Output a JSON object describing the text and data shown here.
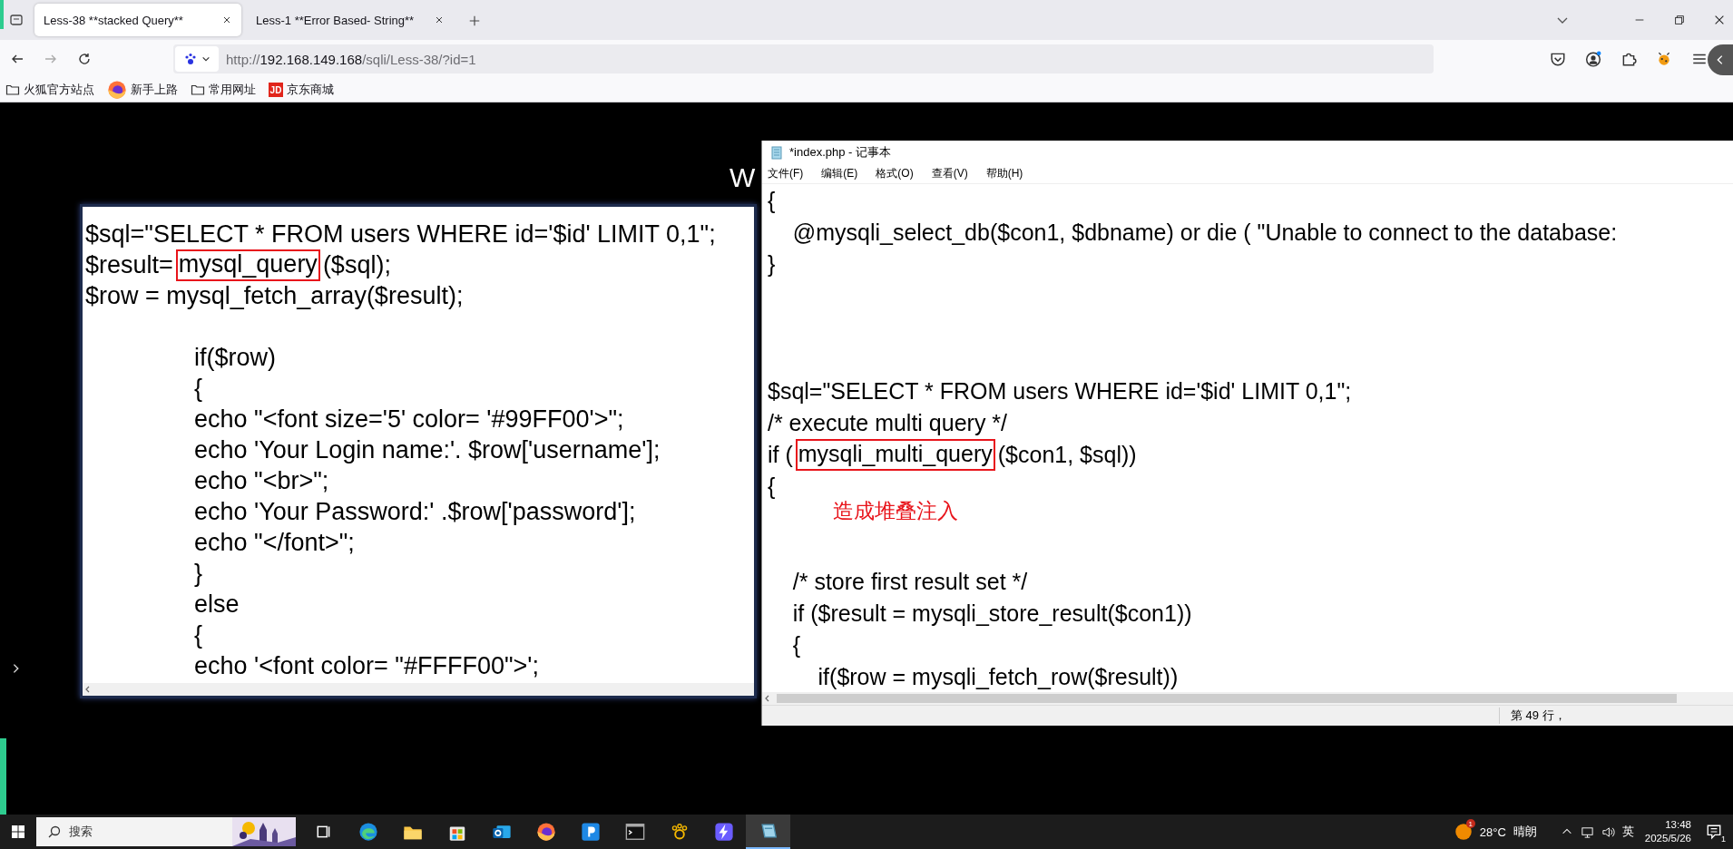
{
  "browser": {
    "tabs": [
      {
        "title": "Less-38 **stacked Query**",
        "selected": true
      },
      {
        "title": "Less-1 **Error Based- String**",
        "selected": false
      }
    ],
    "url": {
      "scheme": "http://",
      "host": "192.168.149.168",
      "path": "/sqli/Less-38/?id=1"
    },
    "bookmarks": [
      {
        "label": "火狐官方站点",
        "kind": "folder"
      },
      {
        "label": "新手上路",
        "kind": "firefox"
      },
      {
        "label": "常用网址",
        "kind": "folder"
      },
      {
        "label": "京东商城",
        "kind": "jd",
        "badge": "JD"
      }
    ]
  },
  "page_fragments": [
    {
      "text": "W",
      "color": "#ffffff"
    }
  ],
  "code_window": {
    "lines": [
      {
        "kind": "plain",
        "text": "$sql=\"SELECT * FROM users WHERE id='$id' LIMIT 0,1\";"
      },
      {
        "kind": "marked",
        "before": "$result=",
        "marked": "mysql_query",
        "after": "($sql);"
      },
      {
        "kind": "plain",
        "text": "$row = mysql_fetch_array($result);"
      },
      {
        "kind": "blank"
      },
      {
        "kind": "plain",
        "text": "\t\tif($row)"
      },
      {
        "kind": "plain",
        "text": "\t\t{"
      },
      {
        "kind": "plain",
        "text": "\t\techo \"<font size='5' color= '#99FF00'>\";"
      },
      {
        "kind": "plain",
        "text": "\t\techo 'Your Login name:'. $row['username'];"
      },
      {
        "kind": "plain",
        "text": "\t\techo \"<br>\";"
      },
      {
        "kind": "plain",
        "text": "\t\techo 'Your Password:' .$row['password'];"
      },
      {
        "kind": "plain",
        "text": "\t\techo \"</font>\";"
      },
      {
        "kind": "plain",
        "text": "\t\t}"
      },
      {
        "kind": "plain",
        "text": "\t\telse"
      },
      {
        "kind": "plain",
        "text": "\t\t{"
      },
      {
        "kind": "plain",
        "text": "\t\techo '<font color= \"#FFFF00\">';"
      }
    ]
  },
  "notepad": {
    "title": "*index.php - 记事本",
    "menu": [
      "文件(F)",
      "编辑(E)",
      "格式(O)",
      "查看(V)",
      "帮助(H)"
    ],
    "lines": [
      {
        "kind": "plain",
        "text": "{"
      },
      {
        "kind": "plain",
        "text": "    @mysqli_select_db($con1, $dbname) or die ( \"Unable to connect to the database:"
      },
      {
        "kind": "plain",
        "text": "}"
      },
      {
        "kind": "blank"
      },
      {
        "kind": "blank"
      },
      {
        "kind": "blank"
      },
      {
        "kind": "plain",
        "text": "$sql=\"SELECT * FROM users WHERE id='$id' LIMIT 0,1\";"
      },
      {
        "kind": "plain",
        "text": "/* execute multi query */"
      },
      {
        "kind": "marked",
        "before": "if (",
        "marked": "mysqli_multi_query",
        "after": "($con1, $sql))"
      },
      {
        "kind": "plain",
        "text": "{"
      },
      {
        "kind": "blank"
      },
      {
        "kind": "blank"
      },
      {
        "kind": "plain",
        "text": "    /* store first result set */"
      },
      {
        "kind": "plain",
        "text": "    if ($result = mysqli_store_result($con1))"
      },
      {
        "kind": "plain",
        "text": "    {"
      },
      {
        "kind": "plain",
        "text": "        if($row = mysqli_fetch_row($result))"
      }
    ],
    "annotation": "造成堆叠注入",
    "status": "第 49 行，"
  },
  "taskbar": {
    "search_placeholder": "搜索",
    "apps": [
      {
        "kind": "taskview",
        "active": false
      },
      {
        "kind": "edge",
        "active": false
      },
      {
        "kind": "explorer",
        "active": false
      },
      {
        "kind": "store",
        "active": false
      },
      {
        "kind": "outlook",
        "active": false
      },
      {
        "kind": "firefox",
        "active": false
      },
      {
        "kind": "p-app",
        "active": false
      },
      {
        "kind": "terminal",
        "active": false
      },
      {
        "kind": "paw",
        "active": false
      },
      {
        "kind": "bolt",
        "active": false
      },
      {
        "kind": "notepad",
        "active": true
      }
    ],
    "weather": {
      "badge": "1",
      "temperature": "28°C",
      "condition": "晴朗"
    },
    "ime": "英",
    "time": "13:48",
    "date": "2025/5/26",
    "notification_count": "1"
  }
}
